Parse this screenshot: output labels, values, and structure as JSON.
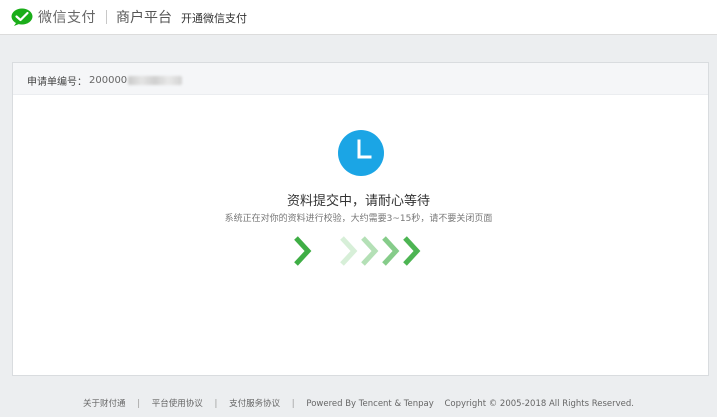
{
  "header": {
    "brand": "微信支付",
    "platform": "商户平台",
    "subtitle": "开通微信支付"
  },
  "application": {
    "label": "申请单编号：",
    "number_visible": "200000"
  },
  "status": {
    "icon": "clock-icon",
    "title": "资料提交中，请耐心等待",
    "description": "系统正在对你的资料进行校验，大约需要3~15秒，请不要关闭页面"
  },
  "footer": {
    "links": [
      "关于财付通",
      "平台使用协议",
      "支付服务协议"
    ],
    "powered": "Powered By Tencent & Tenpay",
    "copyright": "Copyright © 2005-2018 All Rights Reserved."
  },
  "colors": {
    "brand_green": "#1aad19",
    "clock_blue": "#1ba5e5",
    "arrow_green": "#3fae45"
  }
}
